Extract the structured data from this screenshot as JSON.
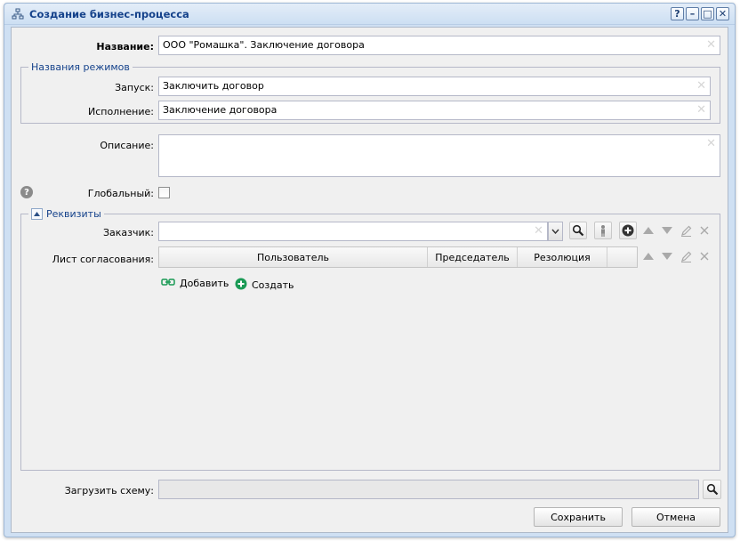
{
  "window": {
    "title": "Создание бизнес-процесса",
    "tool_buttons": [
      "?",
      "–",
      "□",
      "✕"
    ]
  },
  "form": {
    "name_label": "Название:",
    "name_value": "ООО \"Ромашка\". Заключение договора",
    "modes_legend": "Названия режимов",
    "launch_label": "Запуск:",
    "launch_value": "Заключить договор",
    "execution_label": "Исполнение:",
    "execution_value": "Заключение договора",
    "description_label": "Описание:",
    "description_value": "",
    "global_label": "Глобальный:",
    "global_checked": false
  },
  "requisites": {
    "legend": "Реквизиты",
    "customer_label": "Заказчик:",
    "customer_value": "",
    "approval_label": "Лист согласования:",
    "columns": [
      "Пользователь",
      "Председатель",
      "Резолюция"
    ],
    "add_label": "Добавить",
    "create_label": "Создать"
  },
  "footer": {
    "upload_label": "Загрузить схему:",
    "upload_value": "",
    "save_label": "Сохранить",
    "cancel_label": "Отмена"
  },
  "colors": {
    "title": "#15428b",
    "accent_green": "#1a9a55",
    "help_gray": "#8b8b8b"
  },
  "icons": [
    "window-icon",
    "help-icon",
    "search-icon",
    "person-icon",
    "add-icon",
    "arrow-up-icon",
    "arrow-down-icon",
    "edit-icon",
    "delete-icon",
    "chevron-down-icon",
    "link-icon"
  ]
}
